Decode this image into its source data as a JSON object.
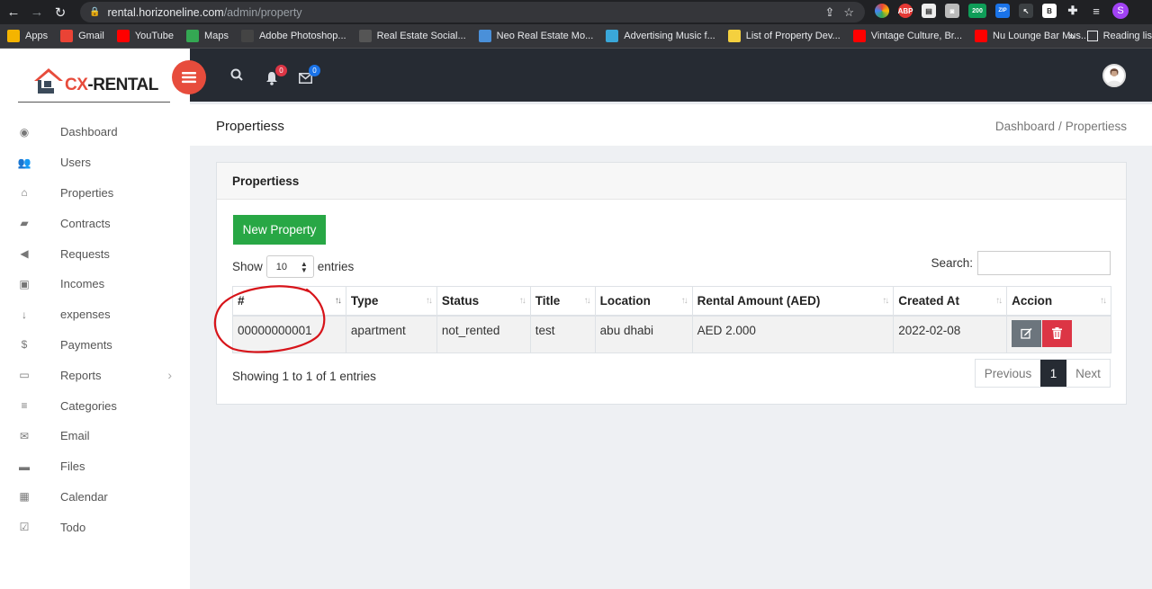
{
  "browser": {
    "url_host": "rental.horizoneline.com",
    "url_path": "/admin/property",
    "bookmarks": [
      {
        "label": "Apps",
        "icon": "apps-grid-icon",
        "color": "#f4b400"
      },
      {
        "label": "Gmail",
        "icon": "gmail-icon",
        "color": "#ea4335"
      },
      {
        "label": "YouTube",
        "icon": "youtube-icon",
        "color": "#ff0000"
      },
      {
        "label": "Maps",
        "icon": "maps-icon",
        "color": "#34a853"
      },
      {
        "label": "Adobe Photoshop...",
        "icon": "photoshop-icon",
        "color": "#444"
      },
      {
        "label": "Real Estate Social...",
        "icon": "realestate-icon",
        "color": "#555"
      },
      {
        "label": "Neo Real Estate Mo...",
        "icon": "neo-icon",
        "color": "#4a90d9"
      },
      {
        "label": "Advertising Music f...",
        "icon": "music-icon",
        "color": "#3aa7d9"
      },
      {
        "label": "List of Property Dev...",
        "icon": "list-icon",
        "color": "#f4d03f"
      },
      {
        "label": "Vintage Culture, Br...",
        "icon": "youtube-icon",
        "color": "#ff0000"
      },
      {
        "label": "Nu Lounge Bar Mus...",
        "icon": "youtube-icon",
        "color": "#ff0000"
      }
    ],
    "bookmarks_more": "»",
    "reading_list": "Reading lis",
    "extension_badge": "200",
    "profile_initial": "S"
  },
  "brand": {
    "prefix": "CX",
    "suffix": "-RENTAL"
  },
  "sidebar": {
    "items": [
      {
        "label": "Dashboard",
        "icon": "dashboard-icon",
        "glyph": "◉"
      },
      {
        "label": "Users",
        "icon": "users-icon",
        "glyph": "👥"
      },
      {
        "label": "Properties",
        "icon": "home-icon",
        "glyph": "⌂"
      },
      {
        "label": "Contracts",
        "icon": "book-icon",
        "glyph": "▰"
      },
      {
        "label": "Requests",
        "icon": "bullhorn-icon",
        "glyph": "◀"
      },
      {
        "label": "Incomes",
        "icon": "money-icon",
        "glyph": "▣"
      },
      {
        "label": "expenses",
        "icon": "sort-amount-icon",
        "glyph": "↓"
      },
      {
        "label": "Payments",
        "icon": "dollar-icon",
        "glyph": "$"
      },
      {
        "label": "Reports",
        "icon": "inbox-icon",
        "glyph": "▭",
        "has_chevron": true
      },
      {
        "label": "Categories",
        "icon": "bars-icon",
        "glyph": "≡"
      },
      {
        "label": "Email",
        "icon": "envelope-icon",
        "glyph": "✉"
      },
      {
        "label": "Files",
        "icon": "folder-icon",
        "glyph": "▬"
      },
      {
        "label": "Calendar",
        "icon": "calendar-icon",
        "glyph": "▦"
      },
      {
        "label": "Todo",
        "icon": "check-square-icon",
        "glyph": "☑"
      }
    ]
  },
  "topbar": {
    "notifications_count": "0",
    "messages_count": "0"
  },
  "page": {
    "title": "Propertiess",
    "breadcrumb": {
      "home": "Dashboard",
      "separator": "/",
      "current": "Propertiess"
    }
  },
  "card": {
    "title": "Propertiess",
    "new_button": "New Property",
    "show_label": "Show",
    "page_length": "10",
    "entries_label": "entries",
    "search_label": "Search:",
    "search_value": "",
    "columns": [
      "#",
      "Type",
      "Status",
      "Title",
      "Location",
      "Rental Amount (AED)",
      "Created At",
      "Accion"
    ],
    "rows": [
      {
        "id": "00000000001",
        "type": "apartment",
        "status": "not_rented",
        "title": "test",
        "location": "abu dhabi",
        "amount": "AED 2.000",
        "created": "2022-02-08"
      }
    ],
    "info": "Showing 1 to 1 of 1 entries",
    "pager": {
      "previous": "Previous",
      "current": "1",
      "next": "Next"
    }
  },
  "colors": {
    "accent": "#e74c3c",
    "topbar": "#262b33",
    "success": "#28a745",
    "danger": "#dc3545",
    "secondary": "#6c757d"
  }
}
